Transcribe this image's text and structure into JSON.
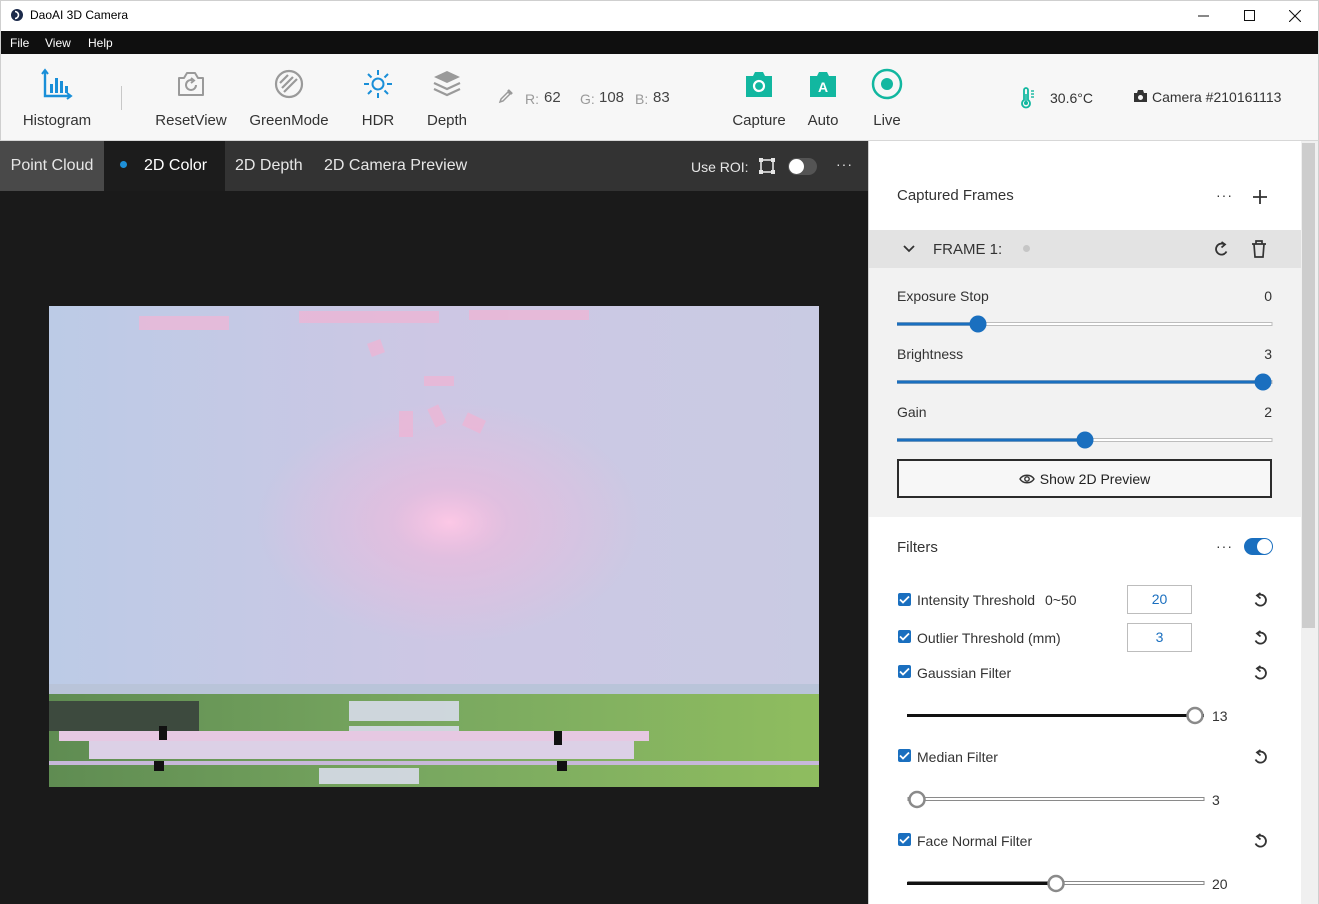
{
  "window": {
    "title": "DaoAI 3D Camera"
  },
  "menu": {
    "items": [
      "File",
      "View",
      "Help"
    ]
  },
  "toolbar": {
    "histogram": "Histogram",
    "reset_view": "ResetView",
    "green_mode": "GreenMode",
    "hdr": "HDR",
    "depth": "Depth",
    "rgb": {
      "r_label": "R:",
      "r": "62",
      "g_label": "G:",
      "g": "108",
      "b_label": "B:",
      "b": "83"
    },
    "capture": "Capture",
    "auto": "Auto",
    "live": "Live",
    "temperature": "30.6°C",
    "camera": "Camera #210161113",
    "accent_color": "#12b7a0",
    "icon_color": "#1a8fd8"
  },
  "viewer": {
    "tabs": [
      "Point Cloud",
      "2D Color",
      "2D Depth",
      "2D Camera Preview"
    ],
    "active_tab": "2D Color",
    "roi_label": "Use ROI:",
    "roi_enabled": false,
    "more": "···"
  },
  "panel": {
    "captured_frames_title": "Captured Frames",
    "more": "···",
    "frame_label": "FRAME 1:",
    "exposure_stop": {
      "label": "Exposure Stop",
      "value": "0",
      "level": 0.22
    },
    "brightness": {
      "label": "Brightness",
      "value": "3",
      "level": 1.0
    },
    "gain": {
      "label": "Gain",
      "value": "2",
      "level": 0.5
    },
    "preview_button": "Show 2D Preview",
    "filters_title": "Filters",
    "filters_enabled": true,
    "intensity_threshold": {
      "label": "Intensity Threshold",
      "range": "0~50",
      "value": "20",
      "checked": true
    },
    "outlier_threshold": {
      "label": "Outlier Threshold (mm)",
      "value": "3",
      "checked": true
    },
    "gaussian_filter": {
      "label": "Gaussian Filter",
      "value": "13",
      "level": 1.0,
      "checked": true
    },
    "median_filter": {
      "label": "Median Filter",
      "value": "3",
      "level": 0.0,
      "checked": true
    },
    "face_normal_filter": {
      "label": "Face Normal Filter",
      "value": "20",
      "level": 0.5,
      "checked": true
    }
  }
}
